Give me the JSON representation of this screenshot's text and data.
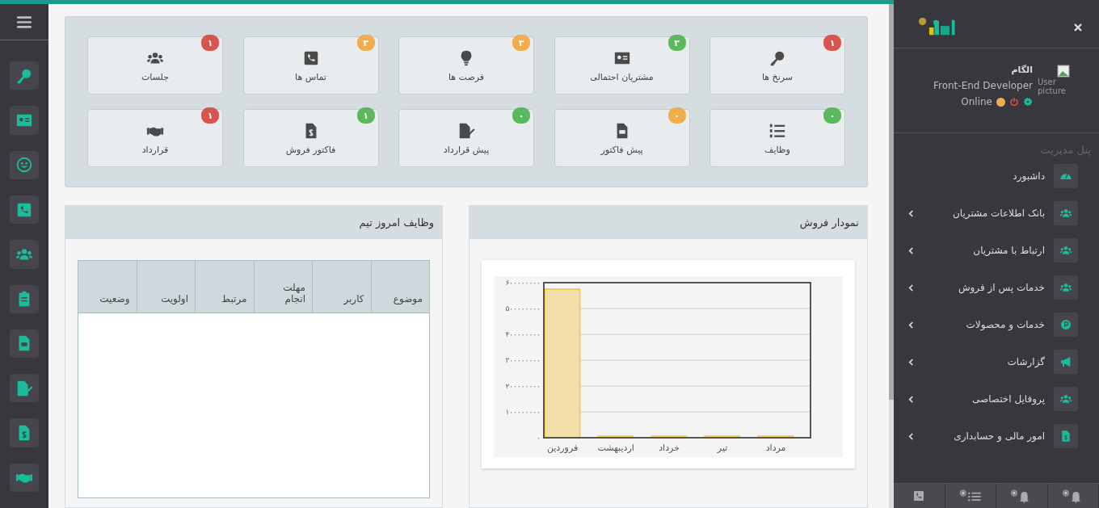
{
  "tiles": [
    {
      "label": "سرنخ ها",
      "count": "۱",
      "color": "#d9534f"
    },
    {
      "label": "مشتریان احتمالی",
      "count": "۲",
      "color": "#5cb85c"
    },
    {
      "label": "فرصت ها",
      "count": "۳",
      "color": "#f0ad4e"
    },
    {
      "label": "تماس ها",
      "count": "۳",
      "color": "#f0ad4e"
    },
    {
      "label": "جلسات",
      "count": "۱",
      "color": "#d9534f"
    },
    {
      "label": "وظایف",
      "count": "۰",
      "color": "#5cb85c"
    },
    {
      "label": "پیش فاکتور",
      "count": "۰",
      "color": "#f0ad4e"
    },
    {
      "label": "پیش قرارداد",
      "count": "۰",
      "color": "#5cb85c"
    },
    {
      "label": "فاکتور فروش",
      "count": "۱",
      "color": "#5cb85c"
    },
    {
      "label": "قرارداد",
      "count": "۱",
      "color": "#d9534f"
    }
  ],
  "sales_panel": {
    "title": "نمودار فروش",
    "chart_data": {
      "type": "bar",
      "categories": [
        "فروردین",
        "اردیبهشت",
        "خرداد",
        "تیر",
        "مرداد"
      ],
      "values": [
        575000000,
        0,
        0,
        0,
        0
      ],
      "ylim": [
        0,
        600000000
      ],
      "grid": true,
      "yticks": [
        {
          "value": 0,
          "label": "۰"
        },
        {
          "value": 100000000,
          "label": "۱۰۰۰۰۰۰۰۰"
        },
        {
          "value": 200000000,
          "label": "۲۰۰۰۰۰۰۰۰"
        },
        {
          "value": 300000000,
          "label": "۳۰۰۰۰۰۰۰۰"
        },
        {
          "value": 400000000,
          "label": "۴۰۰۰۰۰۰۰۰"
        },
        {
          "value": 500000000,
          "label": "۵۰۰۰۰۰۰۰۰"
        },
        {
          "value": 600000000,
          "label": "۶۰۰۰۰۰۰۰۰"
        }
      ]
    }
  },
  "tasks_panel": {
    "title": "وظایف امروز تیم",
    "columns": [
      "موضوع",
      "کاربر",
      "مهلت انجام",
      "مرتبط",
      "اولویت",
      "وضعیت"
    ]
  },
  "user": {
    "name": "الگام",
    "role": "Front-End Developer",
    "status": "Online",
    "picture_alt": "User picture"
  },
  "menu_heading": "پنل مدیریت",
  "menu": [
    {
      "label": "داشبورد",
      "expandable": false
    },
    {
      "label": "بانک اطلاعات مشتریان",
      "expandable": true
    },
    {
      "label": "ارتباط با مشتریان",
      "expandable": true
    },
    {
      "label": "خدمات پس از فروش",
      "expandable": true
    },
    {
      "label": "خدمات و محصولات",
      "expandable": true
    },
    {
      "label": "گزارشات",
      "expandable": true
    },
    {
      "label": "پروفایل اختصاصی",
      "expandable": true
    },
    {
      "label": "امور مالی و حسابداری",
      "expandable": true
    }
  ]
}
